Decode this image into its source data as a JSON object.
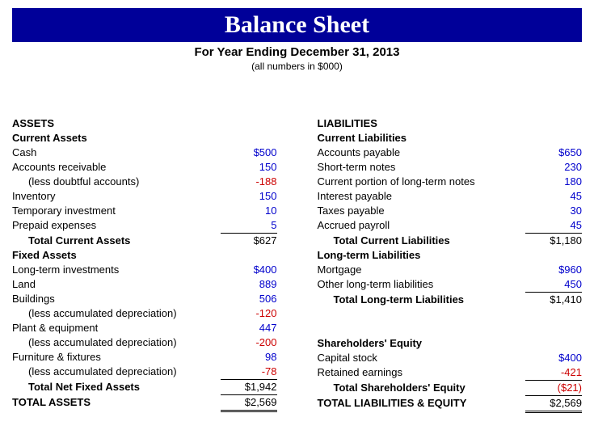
{
  "header": {
    "title": "Balance Sheet",
    "subtitle": "For Year Ending December 31, 2013",
    "note": "(all numbers in $000)"
  },
  "assets": {
    "heading": "ASSETS",
    "current_heading": "Current Assets",
    "cash_label": "Cash",
    "cash_value": "$500",
    "ar_label": "Accounts receivable",
    "ar_value": "150",
    "doubtful_label": "(less doubtful accounts)",
    "doubtful_value": "-188",
    "inventory_label": "Inventory",
    "inventory_value": "150",
    "tempinv_label": "Temporary investment",
    "tempinv_value": "10",
    "prepaid_label": "Prepaid expenses",
    "prepaid_value": "5",
    "total_current_label": "Total Current Assets",
    "total_current_value": "$627",
    "fixed_heading": "Fixed Assets",
    "ltinv_label": "Long-term investments",
    "ltinv_value": "$400",
    "land_label": "Land",
    "land_value": "889",
    "buildings_label": "Buildings",
    "buildings_value": "506",
    "bldg_dep_label": "(less accumulated depreciation)",
    "bldg_dep_value": "-120",
    "plant_label": "Plant & equipment",
    "plant_value": "447",
    "plant_dep_label": "(less accumulated depreciation)",
    "plant_dep_value": "-200",
    "furn_label": "Furniture & fixtures",
    "furn_value": "98",
    "furn_dep_label": "(less accumulated depreciation)",
    "furn_dep_value": "-78",
    "total_fixed_label": "Total Net Fixed Assets",
    "total_fixed_value": "$1,942",
    "total_assets_label": "TOTAL ASSETS",
    "total_assets_value": "$2,569"
  },
  "liab": {
    "heading": "LIABILITIES",
    "current_heading": "Current Liabilities",
    "ap_label": "Accounts payable",
    "ap_value": "$650",
    "stn_label": "Short-term notes",
    "stn_value": "230",
    "cplt_label": "Current portion of long-term notes",
    "cplt_value": "180",
    "intp_label": "Interest payable",
    "intp_value": "45",
    "taxp_label": "Taxes payable",
    "taxp_value": "30",
    "accp_label": "Accrued payroll",
    "accp_value": "45",
    "total_current_label": "Total Current Liabilities",
    "total_current_value": "$1,180",
    "lt_heading": "Long-term Liabilities",
    "mort_label": "Mortgage",
    "mort_value": "$960",
    "otherlt_label": "Other long-term liabilities",
    "otherlt_value": "450",
    "total_lt_label": "Total Long-term Liabilities",
    "total_lt_value": "$1,410",
    "equity_heading": "Shareholders' Equity",
    "cap_label": "Capital stock",
    "cap_value": "$400",
    "ret_label": "Retained earnings",
    "ret_value": "-421",
    "total_eq_label": "Total Shareholders' Equity",
    "total_eq_value": "($21)",
    "total_le_label": "TOTAL LIABILITIES & EQUITY",
    "total_le_value": "$2,569"
  }
}
